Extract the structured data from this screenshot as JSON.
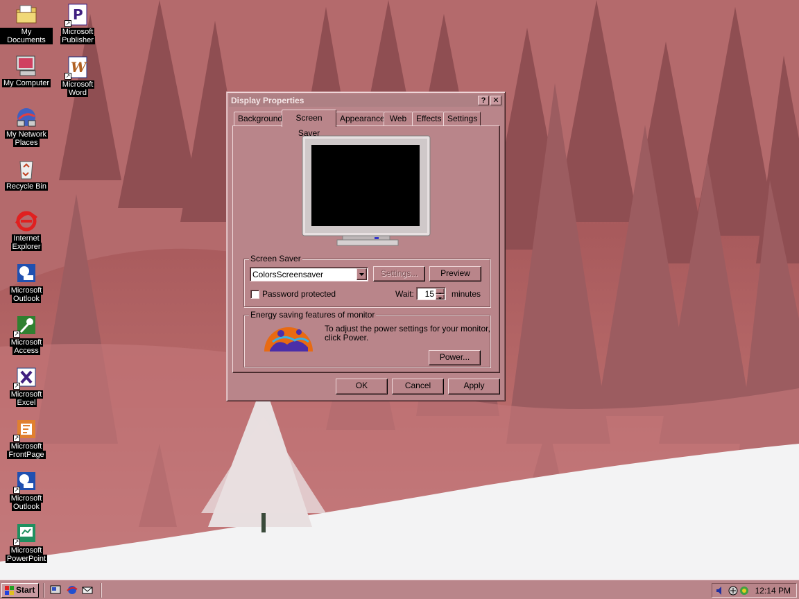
{
  "desktop_icons": [
    {
      "label_lines": [
        "My Documents"
      ],
      "icon": "my-documents-icon",
      "shortcut": false
    },
    {
      "label_lines": [
        "Microsoft",
        "Publisher"
      ],
      "icon": "publisher-icon",
      "shortcut": true
    },
    {
      "label_lines": [
        "My Computer"
      ],
      "icon": "my-computer-icon",
      "shortcut": false
    },
    {
      "label_lines": [
        "Microsoft",
        "Word"
      ],
      "icon": "word-icon",
      "shortcut": true
    },
    {
      "label_lines": [
        "My Network",
        "Places"
      ],
      "icon": "network-places-icon",
      "shortcut": false
    },
    {
      "label_lines": [
        "Recycle Bin"
      ],
      "icon": "recycle-bin-icon",
      "shortcut": false
    },
    {
      "label_lines": [
        "Internet",
        "Explorer"
      ],
      "icon": "internet-explorer-icon",
      "shortcut": false
    },
    {
      "label_lines": [
        "Microsoft",
        "Outlook"
      ],
      "icon": "outlook-icon",
      "shortcut": false
    },
    {
      "label_lines": [
        "Microsoft",
        "Access"
      ],
      "icon": "access-icon",
      "shortcut": true
    },
    {
      "label_lines": [
        "Microsoft",
        "Excel"
      ],
      "icon": "excel-icon",
      "shortcut": true
    },
    {
      "label_lines": [
        "Microsoft",
        "FrontPage"
      ],
      "icon": "frontpage-icon",
      "shortcut": true
    },
    {
      "label_lines": [
        "Microsoft",
        "Outlook"
      ],
      "icon": "outlook-icon",
      "shortcut": true
    },
    {
      "label_lines": [
        "Microsoft",
        "PowerPoint"
      ],
      "icon": "powerpoint-icon",
      "shortcut": true
    }
  ],
  "dialog": {
    "title": "Display Properties",
    "help_button": "?",
    "close_button": "✕",
    "tabs": [
      "Background",
      "Screen Saver",
      "Appearance",
      "Web",
      "Effects",
      "Settings"
    ],
    "active_tab": "Screen Saver",
    "screen_saver": {
      "group_label": "Screen Saver",
      "selected": "ColorsScreensaver",
      "settings_button": "Settings...",
      "preview_button": "Preview",
      "password_label": "Password protected",
      "password_checked": false,
      "wait_label": "Wait:",
      "wait_value": "15",
      "wait_unit": "minutes"
    },
    "energy": {
      "group_label": "Energy saving features of monitor",
      "description_line1": "To adjust the power settings for your monitor,",
      "description_line2": "click Power.",
      "power_button": "Power..."
    },
    "ok_button": "OK",
    "cancel_button": "Cancel",
    "apply_button": "Apply"
  },
  "taskbar": {
    "start_label": "Start",
    "clock": "12:14 PM"
  },
  "colors": {
    "face": "#b9858a",
    "highlight": "#f0d9db",
    "shadow": "#7c5256",
    "dark": "#3c2224"
  }
}
